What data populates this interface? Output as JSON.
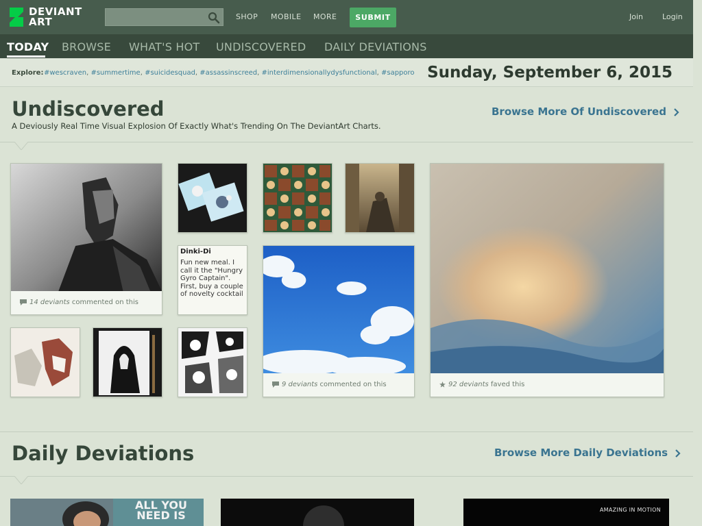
{
  "brand": {
    "line1": "DEVIANT",
    "line2": "ART"
  },
  "header": {
    "search_value": "",
    "nav": [
      "SHOP",
      "MOBILE",
      "MORE"
    ],
    "submit_label": "SUBMIT",
    "join_label": "Join",
    "login_label": "Login"
  },
  "subnav": [
    "TODAY",
    "BROWSE",
    "WHAT'S HOT",
    "UNDISCOVERED",
    "DAILY DEVIATIONS"
  ],
  "explore": {
    "label": "Explore:",
    "tags": [
      "#wescraven",
      "#summertime",
      "#suicidesquad",
      "#assassinscreed",
      "#interdimensionallydysfunctional",
      "#sapporo"
    ]
  },
  "date": "Sunday, September 6, 2015",
  "undiscovered": {
    "title": "Undiscovered",
    "subtitle": "A Deviously Real Time Visual Explosion Of Exactly What's Trending On The DeviantArt Charts.",
    "browse_link": "Browse More Of Undiscovered",
    "tile1": {
      "count": "14 deviants",
      "rest": " commented on this"
    },
    "text_tile": {
      "title": "Dinki-Di",
      "body": "Fun new meal. I call it the \"Hungry Gyro Captain\". First, buy a couple of novelty cocktail"
    },
    "tile_sky": {
      "count": "9 deviants",
      "rest": " commented on this"
    },
    "tile_cloud": {
      "count": "92 deviants",
      "rest": " faved this"
    }
  },
  "daily": {
    "title": "Daily Deviations",
    "browse_link": "Browse More Daily Deviations",
    "poster_text": "ALL YOU NEED IS",
    "overlay_text": "AMAZING IN MOTION"
  },
  "colors": {
    "topbar": "#475c4d",
    "subnav": "#38493c",
    "submit": "#4ca865",
    "link": "#3a7490",
    "background": "#dbe3d5"
  }
}
